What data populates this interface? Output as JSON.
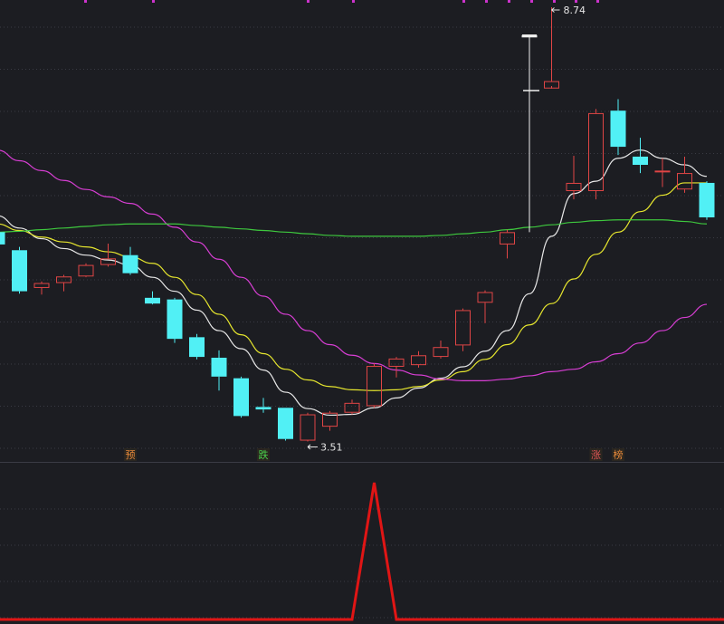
{
  "chart_data": {
    "type": "candlestick",
    "annotations": {
      "high_label": "8.74",
      "low_label": "3.51"
    },
    "markers": [
      {
        "name": "marker-yu",
        "text": "预",
        "candle_index": 6,
        "color": "#e8893a"
      },
      {
        "name": "marker-die",
        "text": "跌",
        "candle_index": 12,
        "color": "#49d14a"
      },
      {
        "name": "marker-zhang",
        "text": "涨",
        "candle_index": 27,
        "color": "#e05555"
      },
      {
        "name": "marker-bang",
        "text": "榜",
        "candle_index": 28,
        "color": "#e8893a"
      }
    ],
    "y_range": [
      3.3,
      8.9
    ],
    "candles": [
      {
        "o": 6.0,
        "c": 5.85,
        "h": 6.08,
        "l": 5.8
      },
      {
        "o": 5.78,
        "c": 5.28,
        "h": 5.82,
        "l": 5.25
      },
      {
        "o": 5.32,
        "c": 5.38,
        "h": 5.4,
        "l": 5.24
      },
      {
        "o": 5.38,
        "c": 5.46,
        "h": 5.48,
        "l": 5.28
      },
      {
        "o": 5.46,
        "c": 5.6,
        "h": 5.62,
        "l": 5.45
      },
      {
        "o": 5.6,
        "c": 5.68,
        "h": 5.86,
        "l": 5.58
      },
      {
        "o": 5.72,
        "c": 5.5,
        "h": 5.82,
        "l": 5.48
      },
      {
        "o": 5.2,
        "c": 5.13,
        "h": 5.28,
        "l": 5.12
      },
      {
        "o": 5.18,
        "c": 4.7,
        "h": 5.2,
        "l": 4.65
      },
      {
        "o": 4.72,
        "c": 4.48,
        "h": 4.76,
        "l": 4.45
      },
      {
        "o": 4.47,
        "c": 4.24,
        "h": 4.56,
        "l": 4.07
      },
      {
        "o": 4.22,
        "c": 3.76,
        "h": 4.24,
        "l": 3.74
      },
      {
        "o": 3.87,
        "c": 3.84,
        "h": 3.98,
        "l": 3.8
      },
      {
        "o": 3.86,
        "c": 3.48,
        "h": 3.86,
        "l": 3.46
      },
      {
        "o": 3.46,
        "c": 3.78,
        "h": 3.8,
        "l": 3.45
      },
      {
        "o": 3.63,
        "c": 3.8,
        "h": 3.82,
        "l": 3.58
      },
      {
        "o": 3.8,
        "c": 3.92,
        "h": 3.96,
        "l": 3.78
      },
      {
        "o": 3.88,
        "c": 4.37,
        "h": 4.4,
        "l": 3.86
      },
      {
        "o": 4.36,
        "c": 4.46,
        "h": 4.48,
        "l": 4.23
      },
      {
        "o": 4.38,
        "c": 4.5,
        "h": 4.55,
        "l": 4.35
      },
      {
        "o": 4.48,
        "c": 4.6,
        "h": 4.68,
        "l": 4.46
      },
      {
        "o": 4.62,
        "c": 5.05,
        "h": 5.07,
        "l": 4.55
      },
      {
        "o": 5.14,
        "c": 5.27,
        "h": 5.29,
        "l": 4.89
      },
      {
        "o": 5.85,
        "c": 6.0,
        "h": 6.03,
        "l": 5.68
      },
      {
        "o": 8.4,
        "c": 8.4,
        "h": 8.4,
        "l": 6.0
      },
      {
        "o": 7.75,
        "c": 7.84,
        "h": 8.74,
        "l": 7.78
      },
      {
        "o": 6.5,
        "c": 6.6,
        "h": 6.93,
        "l": 6.4
      },
      {
        "o": 6.5,
        "c": 7.45,
        "h": 7.5,
        "l": 6.4
      },
      {
        "o": 7.48,
        "c": 7.04,
        "h": 7.62,
        "l": 6.94
      },
      {
        "o": 6.92,
        "c": 6.82,
        "h": 7.15,
        "l": 6.72
      },
      {
        "o": 6.75,
        "c": 6.75,
        "h": 6.9,
        "l": 6.55
      },
      {
        "o": 6.52,
        "c": 6.72,
        "h": 6.92,
        "l": 6.48
      },
      {
        "o": 6.6,
        "c": 6.18,
        "h": 6.62,
        "l": 6.15
      }
    ],
    "ma_lines": [
      {
        "name": "ma-white",
        "color": "#e8e8e8",
        "values": [
          6.2,
          6.05,
          5.92,
          5.8,
          5.72,
          5.66,
          5.6,
          5.45,
          5.28,
          5.05,
          4.8,
          4.58,
          4.32,
          4.05,
          3.85,
          3.77,
          3.78,
          3.86,
          3.98,
          4.1,
          4.22,
          4.36,
          4.55,
          4.8,
          5.25,
          5.95,
          6.47,
          6.62,
          6.9,
          7.0,
          6.9,
          6.82,
          6.68
        ]
      },
      {
        "name": "ma-yellow",
        "color": "#e6e62e",
        "values": [
          6.1,
          6.02,
          5.94,
          5.88,
          5.82,
          5.76,
          5.7,
          5.62,
          5.45,
          5.24,
          5.0,
          4.75,
          4.52,
          4.33,
          4.2,
          4.12,
          4.08,
          4.07,
          4.08,
          4.12,
          4.2,
          4.3,
          4.45,
          4.63,
          4.87,
          5.13,
          5.43,
          5.73,
          6.0,
          6.25,
          6.45,
          6.6,
          6.6
        ]
      },
      {
        "name": "ma-magenta",
        "color": "#d73ed3",
        "values": [
          7.0,
          6.87,
          6.75,
          6.63,
          6.52,
          6.43,
          6.35,
          6.22,
          6.06,
          5.88,
          5.67,
          5.45,
          5.22,
          5.0,
          4.8,
          4.63,
          4.5,
          4.4,
          4.32,
          4.26,
          4.21,
          4.19,
          4.19,
          4.21,
          4.25,
          4.3,
          4.33,
          4.42,
          4.52,
          4.65,
          4.8,
          4.96,
          5.12
        ]
      },
      {
        "name": "ma-green",
        "color": "#3ec83e",
        "values": [
          6.0,
          6.01,
          6.03,
          6.05,
          6.07,
          6.09,
          6.1,
          6.1,
          6.1,
          6.08,
          6.06,
          6.04,
          6.02,
          6.0,
          5.98,
          5.96,
          5.95,
          5.95,
          5.95,
          5.95,
          5.96,
          5.98,
          6.0,
          6.03,
          6.06,
          6.09,
          6.12,
          6.14,
          6.15,
          6.15,
          6.15,
          6.13,
          6.1
        ]
      }
    ],
    "lower_panel": {
      "type": "line",
      "color": "#e01515",
      "values": [
        0,
        0,
        0,
        0,
        0,
        0,
        0,
        0,
        0,
        0,
        0,
        0,
        0,
        0,
        0,
        0,
        0,
        1,
        0,
        0,
        0,
        0,
        0,
        0,
        0,
        0,
        0,
        0,
        0,
        0,
        0,
        0,
        0
      ],
      "y_range": [
        0,
        1
      ]
    },
    "grid": true
  },
  "colors": {
    "background": "#1c1d22",
    "up": "#e04545",
    "down": "#51f0f5",
    "grid": "#3a3b44",
    "axis_dots": "#cc33cc"
  }
}
